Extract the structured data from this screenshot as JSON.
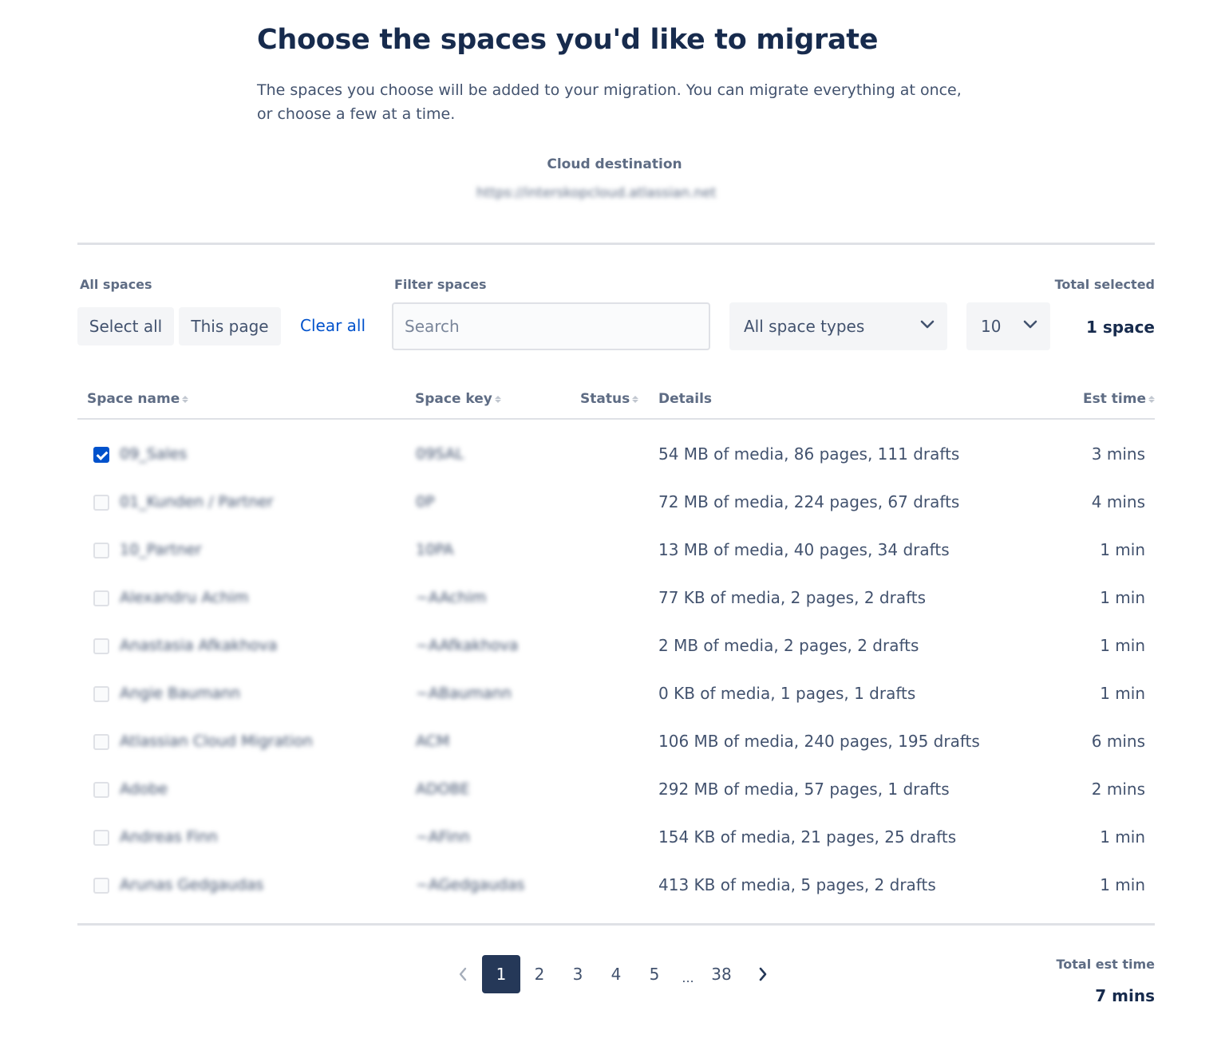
{
  "header": {
    "title": "Choose the spaces you'd like to migrate",
    "description": "The spaces you choose will be added to your migration. You can migrate everything at once, or choose a few at a time."
  },
  "destination": {
    "label": "Cloud destination",
    "url": "https://interskopcloud.atlassian.net"
  },
  "controls": {
    "all_spaces_label": "All spaces",
    "select_all": "Select all",
    "this_page": "This page",
    "clear_all": "Clear all",
    "filter_label": "Filter spaces",
    "search_placeholder": "Search",
    "space_types": "All space types",
    "page_size": "10",
    "total_selected_label": "Total selected",
    "total_selected_value": "1 space"
  },
  "table": {
    "columns": {
      "name": "Space name",
      "key": "Space key",
      "status": "Status",
      "details": "Details",
      "est": "Est time"
    },
    "rows": [
      {
        "name": "09_Sales",
        "key": "09SAL",
        "details": "54 MB of media, 86 pages, 111 drafts",
        "est": "3 mins",
        "checked": true
      },
      {
        "name": "01_Kunden / Partner",
        "key": "0P",
        "details": "72 MB of media, 224 pages, 67 drafts",
        "est": "4 mins",
        "checked": false
      },
      {
        "name": "10_Partner",
        "key": "10PA",
        "details": "13 MB of media, 40 pages, 34 drafts",
        "est": "1 min",
        "checked": false
      },
      {
        "name": "Alexandru Achim",
        "key": "~AAchim",
        "details": "77 KB of media, 2 pages, 2 drafts",
        "est": "1 min",
        "checked": false
      },
      {
        "name": "Anastasia Afkakhova",
        "key": "~AAfkakhova",
        "details": "2 MB of media, 2 pages, 2 drafts",
        "est": "1 min",
        "checked": false
      },
      {
        "name": "Angie Baumann",
        "key": "~ABaumann",
        "details": "0 KB of media, 1 pages, 1 drafts",
        "est": "1 min",
        "checked": false
      },
      {
        "name": "Atlassian Cloud Migration",
        "key": "ACM",
        "details": "106 MB of media, 240 pages, 195 drafts",
        "est": "6 mins",
        "checked": false
      },
      {
        "name": "Adobe",
        "key": "ADOBE",
        "details": "292 MB of media, 57 pages, 1 drafts",
        "est": "2 mins",
        "checked": false
      },
      {
        "name": "Andreas Finn",
        "key": "~AFinn",
        "details": "154 KB of media, 21 pages, 25 drafts",
        "est": "1 min",
        "checked": false
      },
      {
        "name": "Arunas Gedgaudas",
        "key": "~AGedgaudas",
        "details": "413 KB of media, 5 pages, 2 drafts",
        "est": "1 min",
        "checked": false
      }
    ]
  },
  "pagination": {
    "pages": [
      "1",
      "2",
      "3",
      "4",
      "5",
      "...",
      "38"
    ],
    "current": "1"
  },
  "footer": {
    "total_est_label": "Total est time",
    "total_est_value": "7 mins"
  }
}
